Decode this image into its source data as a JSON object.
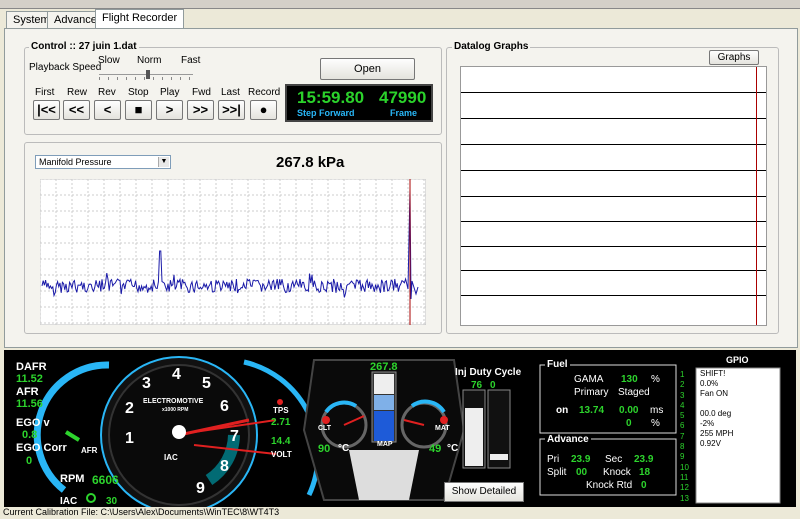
{
  "tabs": [
    {
      "label": "System"
    },
    {
      "label": "Advanced"
    },
    {
      "label": "Flight Recorder"
    }
  ],
  "control": {
    "title": "Control :: 27 juin 1.dat",
    "playback_speed_label": "Playback Speed",
    "speed_slow": "Slow",
    "speed_norm": "Norm",
    "speed_fast": "Fast",
    "open_button": "Open",
    "transport": [
      {
        "label": "First",
        "glyph": "|<<"
      },
      {
        "label": "Rew",
        "glyph": "<<"
      },
      {
        "label": "Rev",
        "glyph": "<"
      },
      {
        "label": "Stop",
        "glyph": "■"
      },
      {
        "label": "Play",
        "glyph": ">"
      },
      {
        "label": "Fwd",
        "glyph": ">>"
      },
      {
        "label": "Last",
        "glyph": ">>|"
      },
      {
        "label": "Record",
        "glyph": "●"
      }
    ],
    "time_value": "15:59.80",
    "frame_value": "47990",
    "time_caption": "Step Forward",
    "frame_caption": "Frame"
  },
  "graph": {
    "selected_channel": "Manifold Pressure",
    "reading": "267.8 kPa",
    "trace_color": "#1a1aa8"
  },
  "datalog": {
    "title": "Datalog Graphs",
    "graphs_button": "Graphs"
  },
  "dash": {
    "dafr_label": "DAFR",
    "dafr_value": "11.52",
    "afr_label": "AFR",
    "afr_value": "11.56",
    "egov_label": "EGO v",
    "egov_value": "0.8",
    "egoc_label": "EGO Corr",
    "egoc_value": "0",
    "afr_small": "AFR",
    "rpm_label": "RPM",
    "rpm_value": "6606",
    "iac_label": "IAC",
    "iac_value": "30",
    "tach_brand": "ELECTROMOTIVE",
    "tach_sub": "x1000 RPM",
    "tach_numbers": [
      "1",
      "2",
      "3",
      "4",
      "5",
      "6",
      "7",
      "8",
      "9"
    ],
    "tach_iac": "IAC",
    "tps_label": "TPS",
    "tps_value": "2.71",
    "volt_value": "14.4",
    "volt_label": "VOLT",
    "map_value": "267.8",
    "map_label": "MAP",
    "clt_label": "CLT",
    "clt_value": "90",
    "clt_unit": "°C",
    "mat_label": "MAT",
    "mat_value": "49",
    "mat_unit": "°C",
    "inj_title": "Inj Duty Cycle",
    "inj_primary": "76",
    "inj_secondary": "0",
    "show_detail_button": "Show Detailed Info",
    "fuel": {
      "title": "Fuel",
      "gama_label": "GAMA",
      "gama_value": "130",
      "gama_unit": "%",
      "primary_label": "Primary",
      "staged_label": "Staged",
      "on_label": "on",
      "primary_value": "13.74",
      "staged_value": "0.00",
      "ms_unit": "ms",
      "staged_pct": "0",
      "pct_unit": "%"
    },
    "advance": {
      "title": "Advance",
      "pri_label": "Pri",
      "pri_value": "23.9",
      "sec_label": "Sec",
      "sec_value": "23.9",
      "split_label": "Split",
      "split_value": "00",
      "knock_label": "Knock",
      "knock_value": "18",
      "knock_rtd_label": "Knock Rtd",
      "knock_rtd_value": "0"
    },
    "gpio": {
      "title": "GPIO",
      "numbers": [
        "1",
        "2",
        "3",
        "4",
        "5",
        "6",
        "7",
        "8",
        "9",
        "10",
        "11",
        "12",
        "13"
      ],
      "lines": [
        "SHIFT!",
        "0.0%",
        "Fan ON",
        "",
        "00.0 deg",
        "-2%",
        "255 MPH",
        "0.92V"
      ]
    }
  },
  "status_bar": "Current Calibration File: C:\\Users\\Alex\\Documents\\WinTEC\\8\\WT4T3"
}
